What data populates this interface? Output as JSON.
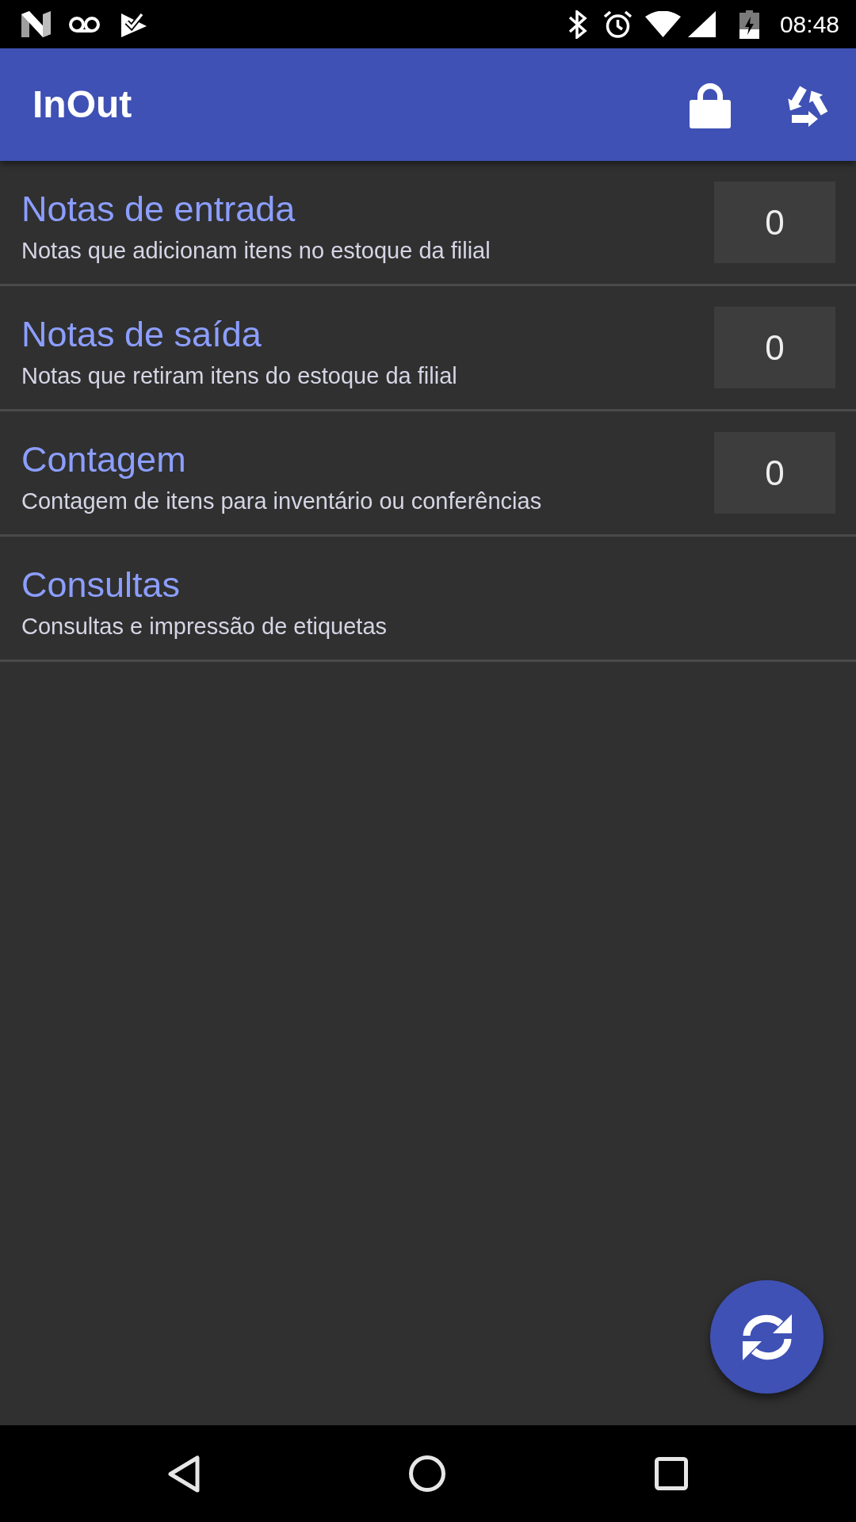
{
  "status_bar": {
    "time": "08:48"
  },
  "app_bar": {
    "title": "InOut"
  },
  "menu_items": [
    {
      "title": "Notas de entrada",
      "subtitle": "Notas que adicionam itens no estoque da filial",
      "count": "0"
    },
    {
      "title": "Notas de saída",
      "subtitle": "Notas que retiram itens do estoque da filial",
      "count": "0"
    },
    {
      "title": "Contagem",
      "subtitle": "Contagem de itens para inventário ou conferências",
      "count": "0"
    },
    {
      "title": "Consultas",
      "subtitle": "Consultas e impressão de etiquetas"
    }
  ]
}
